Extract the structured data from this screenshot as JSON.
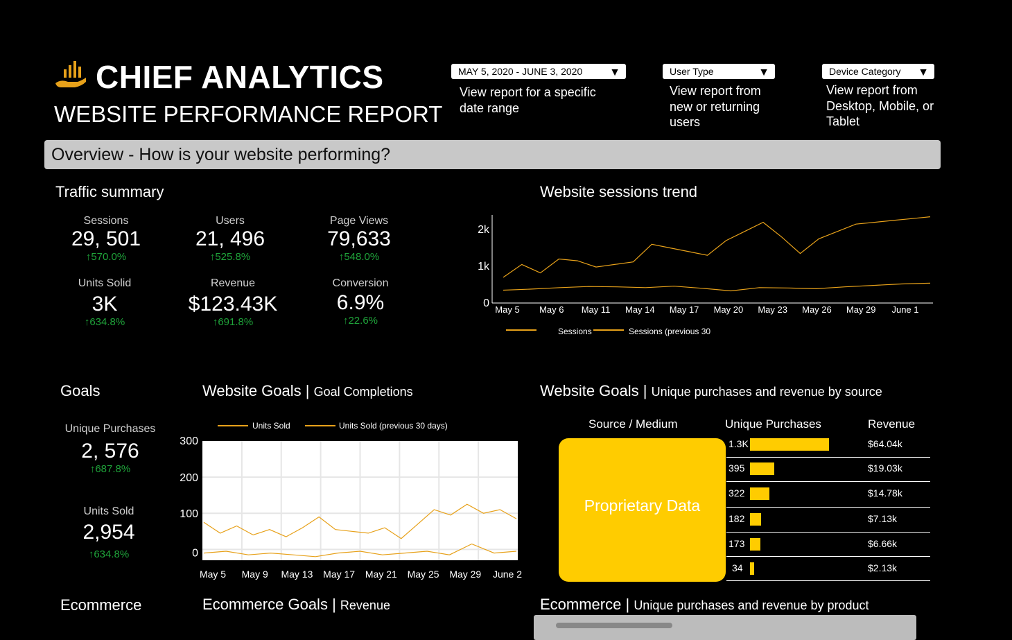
{
  "header": {
    "app_title": "CHIEF ANALYTICS",
    "report_title": "WEBSITE PERFORMANCE REPORT",
    "logo_icon": "hand-bar-chart-icon"
  },
  "filters": {
    "date": {
      "value": "MAY 5, 2020 - JUNE 3, 2020",
      "description": "View report for a specific date range"
    },
    "user_type": {
      "value": "User Type",
      "description": "View report from new or returning users"
    },
    "device": {
      "value": "Device Category",
      "description": "View report from Desktop, Mobile, or Tablet"
    }
  },
  "overview": {
    "title": "Overview - How is your website performing?"
  },
  "traffic_summary": {
    "title": "Traffic summary",
    "kpis": [
      {
        "label": "Sessions",
        "value": "29, 501",
        "change": "↑570.0%"
      },
      {
        "label": "Users",
        "value": "21, 496",
        "change": "↑525.8%"
      },
      {
        "label": "Page Views",
        "value": "79,633",
        "change": "↑548.0%"
      },
      {
        "label": "Units Solid",
        "value": "3K",
        "change": "↑634.8%"
      },
      {
        "label": "Revenue",
        "value": "$123.43K",
        "change": "↑691.8%"
      },
      {
        "label": "Conversion",
        "value": "6.9%",
        "change": "↑22.6%"
      }
    ]
  },
  "sessions_trend": {
    "title": "Website sessions trend",
    "legend": [
      "Sessions",
      "Sessions (previous 30"
    ]
  },
  "goals": {
    "title": "Goals",
    "kpis": [
      {
        "label": "Unique Purchases",
        "value": "2, 576",
        "change": "↑687.8%"
      },
      {
        "label": "Units Sold",
        "value": "2,954",
        "change": "↑634.8%"
      }
    ]
  },
  "website_goals": {
    "title": "Website Goals",
    "subtitle": "Goal Completions",
    "legend": [
      "Units Sold",
      "Units Sold (previous 30 days)"
    ]
  },
  "source_goals": {
    "title": "Website Goals",
    "subtitle": "Unique purchases and revenue by source",
    "headers": [
      "Source / Medium",
      "Unique Purchases",
      "Revenue"
    ],
    "placeholder": "Proprietary Data",
    "rows": [
      {
        "count": "1.3K",
        "value": 1300,
        "revenue": "$64.04k"
      },
      {
        "count": "395",
        "value": 395,
        "revenue": "$19.03k"
      },
      {
        "count": "322",
        "value": 322,
        "revenue": "$14.78k"
      },
      {
        "count": "182",
        "value": 182,
        "revenue": "$7.13k"
      },
      {
        "count": "173",
        "value": 173,
        "revenue": "$6.66k"
      },
      {
        "count": "34",
        "value": 34,
        "revenue": "$2.13k"
      }
    ]
  },
  "ecommerce": {
    "title": "Ecommerce",
    "goals_title": "Ecommerce Goals",
    "goals_subtitle": "Revenue",
    "product_title": "Ecommerce",
    "product_subtitle": "Unique purchases and revenue by product"
  },
  "colors": {
    "accent": "#ffcc00",
    "line": "#e7a11a",
    "positive": "#1fa33a",
    "overview_bg": "#c8c8c8"
  },
  "chart_data": [
    {
      "type": "line",
      "title": "Website sessions trend",
      "x_ticks": [
        "May 5",
        "May 6",
        "May 11",
        "May 14",
        "May 17",
        "May 20",
        "May 23",
        "May 26",
        "May 29",
        "June 1"
      ],
      "y_ticks": [
        "0",
        "1k",
        "2k"
      ],
      "ylim": [
        0,
        2400
      ],
      "grid": false,
      "legend_position": "bottom",
      "series": [
        {
          "name": "Sessions",
          "values": [
            700,
            1050,
            820,
            1200,
            1150,
            980,
            1050,
            1120,
            1600,
            1500,
            1400,
            1300,
            1700,
            1950,
            2200,
            1800,
            1350,
            1750,
            1950,
            2150,
            2200,
            2250,
            2300,
            2350
          ]
        },
        {
          "name": "Sessions (previous 30",
          "values": [
            350,
            380,
            420,
            450,
            440,
            420,
            460,
            400,
            330,
            420,
            410,
            390,
            440,
            480,
            520,
            540
          ]
        }
      ]
    },
    {
      "type": "line",
      "title": "Website Goals | Goal Completions",
      "x_ticks": [
        "May 5",
        "May 9",
        "May 13",
        "May 17",
        "May 21",
        "May 25",
        "May 29",
        "June 2"
      ],
      "y_ticks": [
        "0",
        "100",
        "200",
        "300"
      ],
      "ylim": [
        -30,
        300
      ],
      "grid": true,
      "legend_position": "top",
      "series": [
        {
          "name": "Units Sold",
          "values": [
            75,
            45,
            65,
            40,
            55,
            35,
            60,
            90,
            55,
            50,
            45,
            60,
            30,
            70,
            110,
            95,
            125,
            100,
            110,
            85
          ]
        },
        {
          "name": "Units Sold (previous 30 days)",
          "values": [
            -10,
            -5,
            -15,
            -10,
            -15,
            -20,
            -10,
            -5,
            -15,
            -10,
            -5,
            -15,
            15,
            -10,
            -5
          ]
        }
      ]
    },
    {
      "type": "bar",
      "title": "Unique Purchases",
      "categories": [
        "1.3K",
        "395",
        "322",
        "182",
        "173",
        "34"
      ],
      "values": [
        1300,
        395,
        322,
        182,
        173,
        34
      ]
    }
  ]
}
